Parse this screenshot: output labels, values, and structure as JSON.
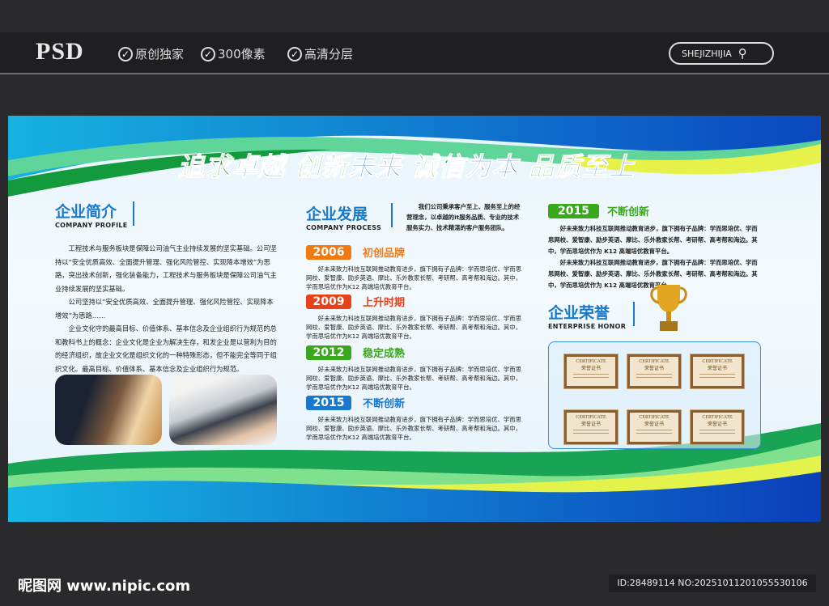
{
  "header": {
    "logo": "PSD",
    "features": [
      "原创独家",
      "300像素",
      "高清分层"
    ],
    "search_label": "SHEJIZHIJIA"
  },
  "board": {
    "slogan": [
      {
        "text": "追求",
        "color": "green"
      },
      {
        "text": "卓越",
        "color": "blue"
      },
      {
        "text": "创新",
        "color": "green"
      },
      {
        "text": "未来",
        "color": "blue"
      },
      {
        "text": "诚信",
        "color": "green"
      },
      {
        "text": "为本",
        "color": "blue"
      },
      {
        "text": "品质",
        "color": "green"
      },
      {
        "text": "至上",
        "color": "blue"
      }
    ],
    "profile": {
      "title": "企业简介",
      "subtitle": "COMPANY PROFILE",
      "paragraphs": [
        "工程技术与服务板块是保障公司油气主业持续发展的坚实基础。公司坚持以“安全优质高效、全面提升管理、强化风险管控、实现降本增效”为思路，突出技术创新，强化装备能力，工程技术与服务板块是保障公司油气主业持续发展的坚实基础。",
        "公司坚持以“安全优质高效、全面提升管理、强化风险管控、实现降本增效”为思路……",
        "企业文化守的最高目标、价值体系、基本信念及企业组织行为规范的总和教科书上的概念：企业文化是企业为解决生存，和发企业是以营利为目的的经济组织，故企业文化是组织文化的一种特殊形态，但不能完全等同于组织文化。最高目标、价值体系、基本信念及企业组织行为规范。"
      ]
    },
    "process": {
      "title": "企业发展",
      "subtitle": "COMPANY PROCESS",
      "intro": "我们公司秉承客户至上、服务至上的经营理念，以卓越的it服务品质、专业的技术服务实力、技术精湛的客户服务团队。",
      "milestones": [
        {
          "year": "2006",
          "label": "初创品牌",
          "color": "#f07a10",
          "text": "好未来致力科技互联网推动教育进步，旗下拥有子品牌：学而思培优、学而思网校、爱智康、励步英语、摩比、乐外教家长帮、考研帮、高考帮和海边。其中，学而思培优作为K12 高端培优教育平台。"
        },
        {
          "year": "2009",
          "label": "上升时期",
          "color": "#e8411a",
          "text": "好未来致力科技互联网推动教育进步，旗下拥有子品牌：学而思培优、学而思网校、爱智康、励步英语、摩比、乐外教家长帮、考研帮、高考帮和海边。其中，学而思培优作为K12 高端培优教育平台。"
        },
        {
          "year": "2012",
          "label": "稳定成熟",
          "color": "#3aa81c",
          "text": "好未来致力科技互联网推动教育进步，旗下拥有子品牌：学而思培优、学而思网校、爱智康、励步英语、摩比、乐外教家长帮、考研帮、高考帮和海边。其中，学而思培优作为K12 高端培优教育平台。"
        },
        {
          "year": "2015",
          "label": "不断创新",
          "color": "#1a78cc",
          "text": "好未来致力科技互联网推动教育进步，旗下拥有子品牌：学而思培优、学而思网校、爱智康、励步英语、摩比、乐外教家长帮、考研帮、高考帮和海边。其中，学而思培优作为K12 高端培优教育平台。"
        }
      ]
    },
    "right": {
      "year": "2015",
      "label": "不断创新",
      "paragraphs": [
        "好未来致力科技互联网推动教育进步，旗下拥有子品牌：学而思培优、学而思网校、爱智康、励步英语、摩比、乐外教家长帮、考研帮、高考帮和海边。其中，学而思培优作为 K12 高端培优教育平台。",
        "好未来致力科技互联网推动教育进步，旗下拥有子品牌：学而思培优、学而思网校、爱智康、励步英语、摩比、乐外教家长帮、考研帮、高考帮和海边。其中，学而思培优作为 K12 高端培优教育平台。"
      ]
    },
    "honor": {
      "title": "企业荣誉",
      "subtitle": "ENTERPRISE HONOR",
      "certificates": [
        "CERTIFICATE",
        "CERTIFICATE",
        "CERTIFICATE",
        "CERTIFICATE",
        "CERTIFICATE",
        "CERTIFICATE"
      ],
      "cert_sub": "荣誉证书"
    }
  },
  "footer": {
    "site": "昵图网 www.nipic.com",
    "id": "ID:28489114 NO:20251011201055530106"
  },
  "colors": {
    "blue": "#1a6fc6",
    "green": "#2aa11c"
  }
}
